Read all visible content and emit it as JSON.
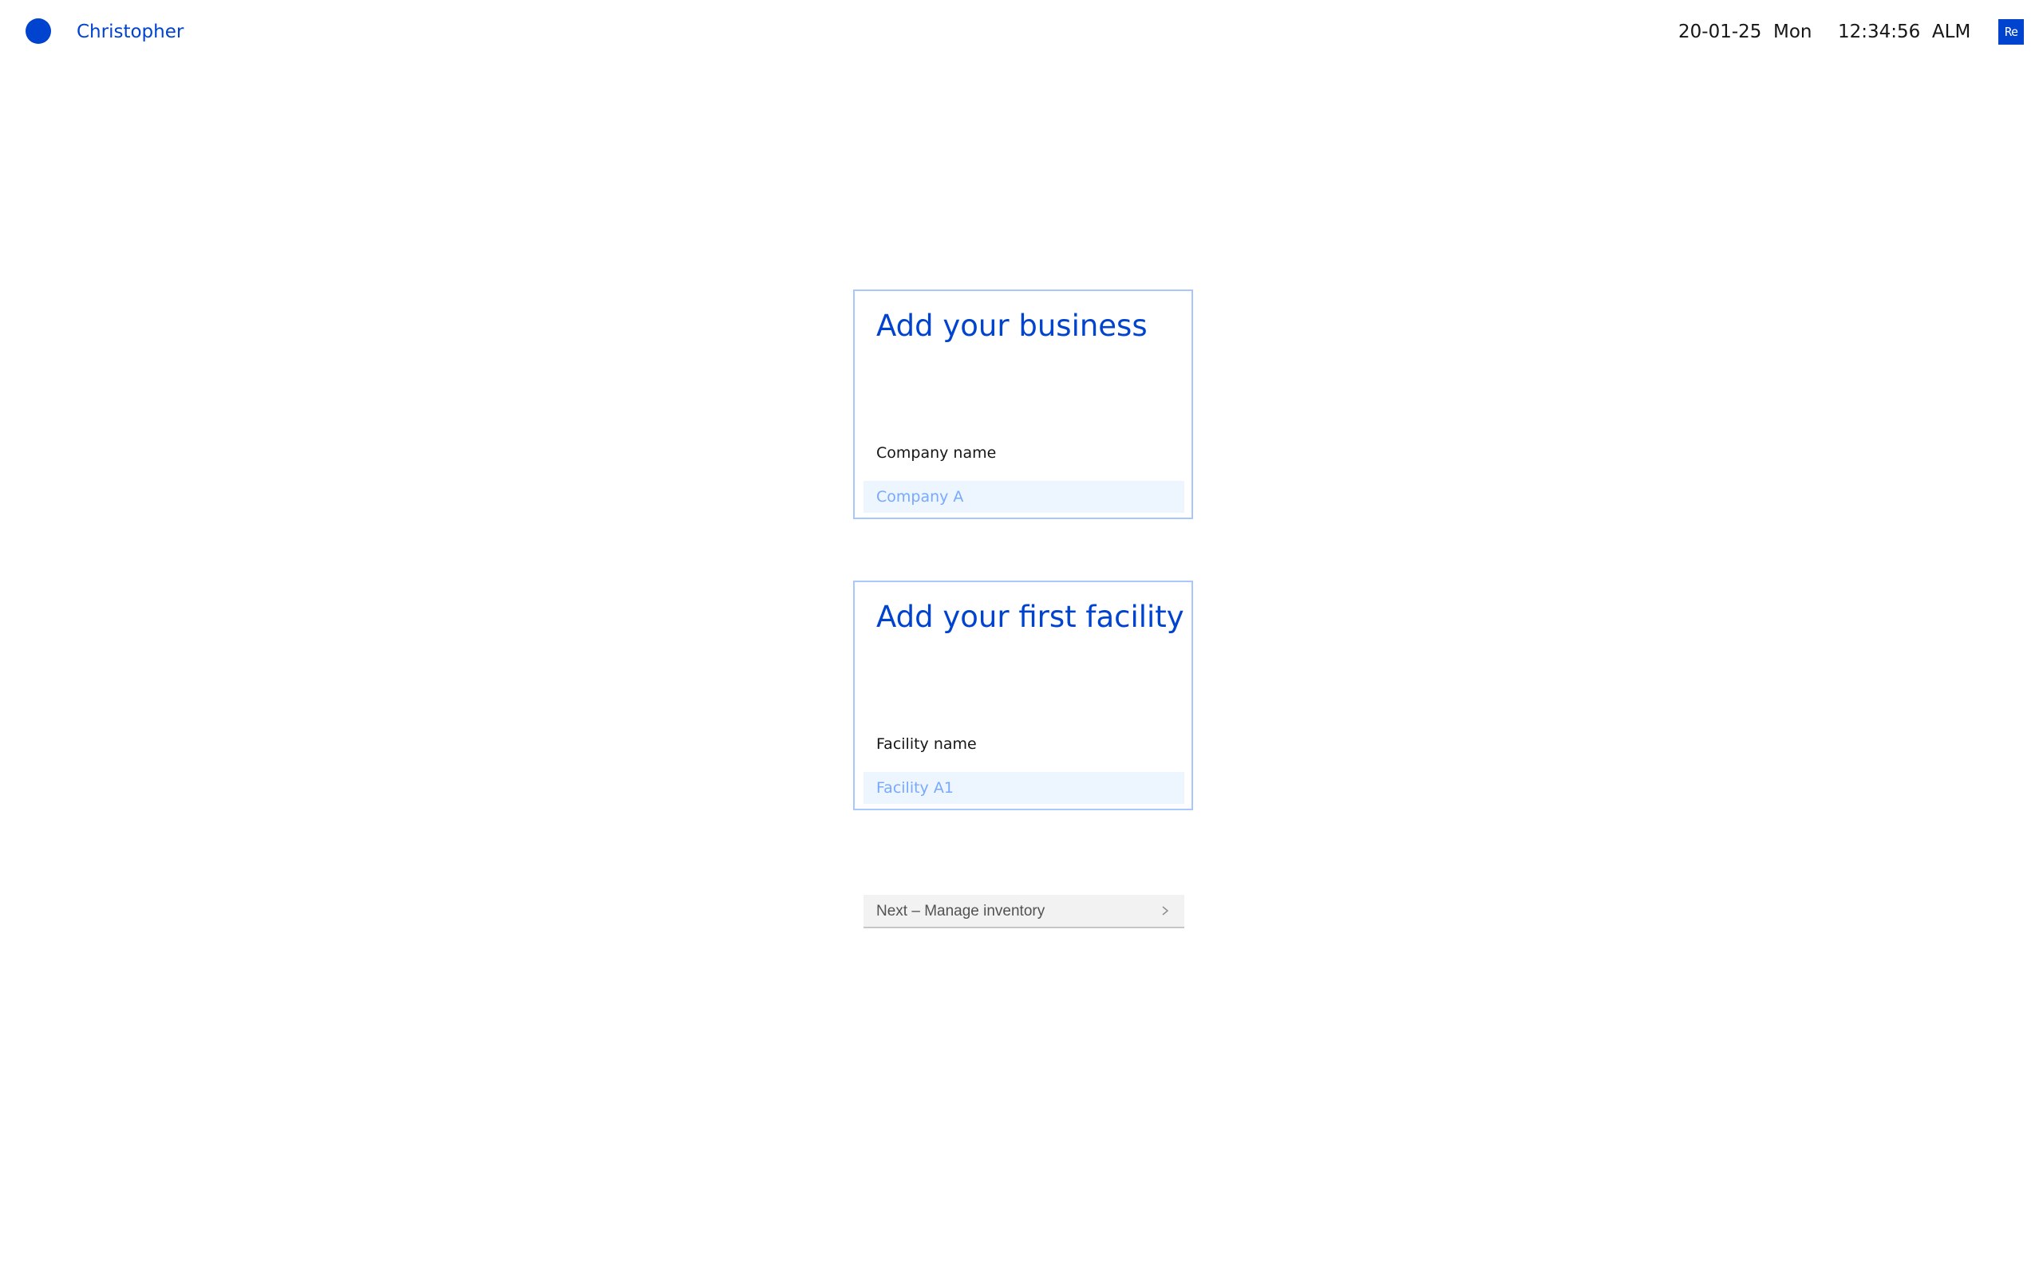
{
  "header": {
    "user_name": "Christopher",
    "date": "20-01-25  Mon",
    "time": "12:34:56  ALM",
    "brand_text": "Re",
    "accent_color": "#0043ce"
  },
  "business_card": {
    "title": "Add your business",
    "field_label": "Company name",
    "field_placeholder": "Company A",
    "field_value": ""
  },
  "facility_card": {
    "title": "Add your first facility",
    "field_label": "Facility name",
    "field_placeholder": "Facility A1",
    "field_value": ""
  },
  "next_button": {
    "label": "Next – Manage inventory",
    "icon": "chevron-right-icon"
  }
}
